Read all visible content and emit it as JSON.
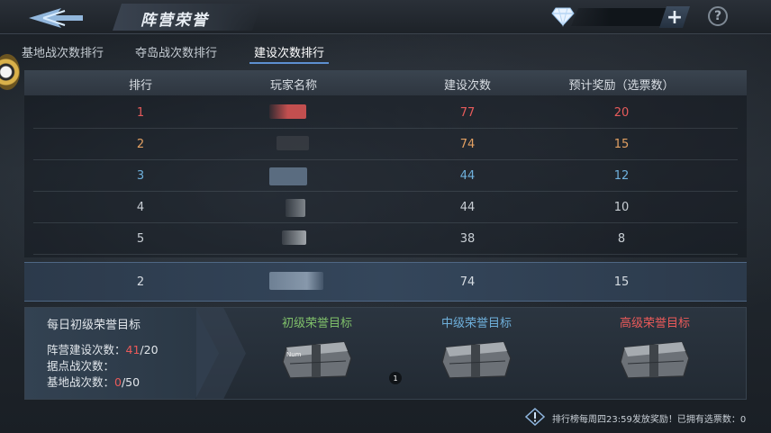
{
  "header": {
    "title": "阵营荣誉",
    "currency_value": "",
    "plus_label": "+",
    "help_label": "?"
  },
  "tabs": [
    {
      "label": "基地战次数排行",
      "active": false
    },
    {
      "label": "夺岛战次数排行",
      "active": false
    },
    {
      "label": "建设次数排行",
      "active": true
    }
  ],
  "table": {
    "columns": [
      "排行",
      "玩家名称",
      "建设次数",
      "预计奖励（选票数）"
    ],
    "rows": [
      {
        "rank": "1",
        "count": "77",
        "reward": "20",
        "color": "#e65b5b"
      },
      {
        "rank": "2",
        "count": "74",
        "reward": "15",
        "color": "#e3a062"
      },
      {
        "rank": "3",
        "count": "44",
        "reward": "12",
        "color": "#6fb0dc"
      },
      {
        "rank": "4",
        "count": "44",
        "reward": "10",
        "color": "#c9cfd5"
      },
      {
        "rank": "5",
        "count": "38",
        "reward": "8",
        "color": "#c9cfd5"
      }
    ],
    "self_row": {
      "rank": "2",
      "count": "74",
      "reward": "15"
    }
  },
  "goals": {
    "title": "每日初级荣誉目标",
    "lines": [
      {
        "label": "阵营建设次数：",
        "current": "41",
        "target": "/20"
      },
      {
        "label": "据点战次数：",
        "current": "",
        "target": ""
      },
      {
        "label": "基地战次数：",
        "current": "0",
        "target": "/50"
      }
    ],
    "tiers": [
      {
        "label": "初级荣誉目标",
        "color": "#7fbf6a",
        "chest_text": "Num"
      },
      {
        "label": "中级荣誉目标",
        "color": "#6fb0dc",
        "chest_text": ""
      },
      {
        "label": "高级荣誉目标",
        "color": "#ea5a5a",
        "chest_text": ""
      }
    ],
    "badge": "1"
  },
  "footer": {
    "note": "排行榜每周四23:59发放奖励！已拥有选票数：0"
  }
}
